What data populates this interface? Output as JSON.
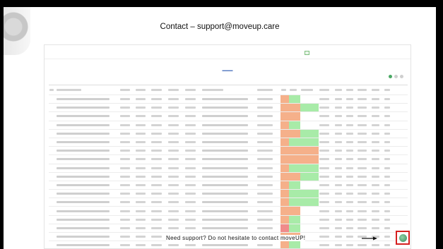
{
  "slide": {
    "title": "Contact – support@moveup.care",
    "footer_message": "Need support? Do not hesitate to contact moveUP!"
  },
  "icons": {
    "help_button": "chat-help-icon",
    "arrow": "arrow-right-icon",
    "corner": "headset-decoration"
  },
  "colors": {
    "status_orange": "#f5b08a",
    "status_green": "#a8eba8",
    "status_red": "#f08a8a",
    "highlight_border": "#d62020"
  },
  "embedded_screenshot": {
    "row_status": [
      [
        "orange",
        "green",
        "none"
      ],
      [
        "orange",
        "orange",
        "green"
      ],
      [
        "orange",
        "orange",
        "none"
      ],
      [
        "orange",
        "green",
        "none"
      ],
      [
        "orange",
        "orange",
        "green"
      ],
      [
        "orange",
        "green",
        "green"
      ],
      [
        "orange",
        "orange",
        "orange"
      ],
      [
        "orange",
        "orange",
        "orange"
      ],
      [
        "orange",
        "green",
        "green"
      ],
      [
        "orange",
        "orange",
        "green"
      ],
      [
        "orange",
        "green",
        "none"
      ],
      [
        "orange",
        "green",
        "green"
      ],
      [
        "orange",
        "green",
        "green"
      ],
      [
        "orange",
        "orange",
        "none"
      ],
      [
        "orange",
        "green",
        "none"
      ],
      [
        "red",
        "green",
        "none"
      ],
      [
        "orange",
        "orange",
        "none"
      ],
      [
        "orange",
        "green",
        "none"
      ]
    ]
  }
}
